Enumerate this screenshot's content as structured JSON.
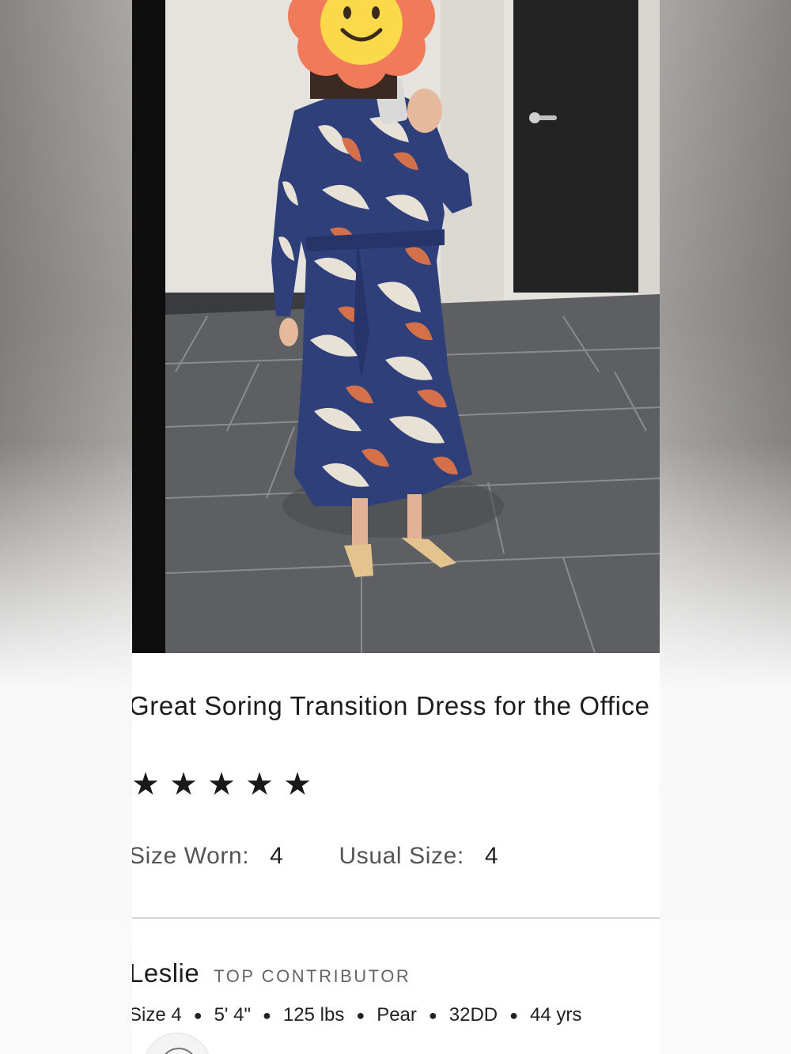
{
  "review": {
    "title": "Great Soring Transition Dress for the Office",
    "rating": 5,
    "stars": [
      "★",
      "★",
      "★",
      "★",
      "★"
    ],
    "size_worn_label": "Size Worn:",
    "size_worn_value": "4",
    "usual_size_label": "Usual Size:",
    "usual_size_value": "4"
  },
  "reviewer": {
    "name": "Leslie",
    "badge": "TOP CONTRIBUTOR",
    "stats": [
      "Size 4",
      "5' 4\"",
      "125 lbs",
      "Pear",
      "32DD",
      "44 yrs"
    ]
  },
  "colors": {
    "dress_navy": "#2f3f7a",
    "dress_rust": "#d4704a",
    "dress_cream": "#e8e2d6",
    "emoji_petal": "#f07a5a",
    "emoji_face": "#fcd94a"
  }
}
